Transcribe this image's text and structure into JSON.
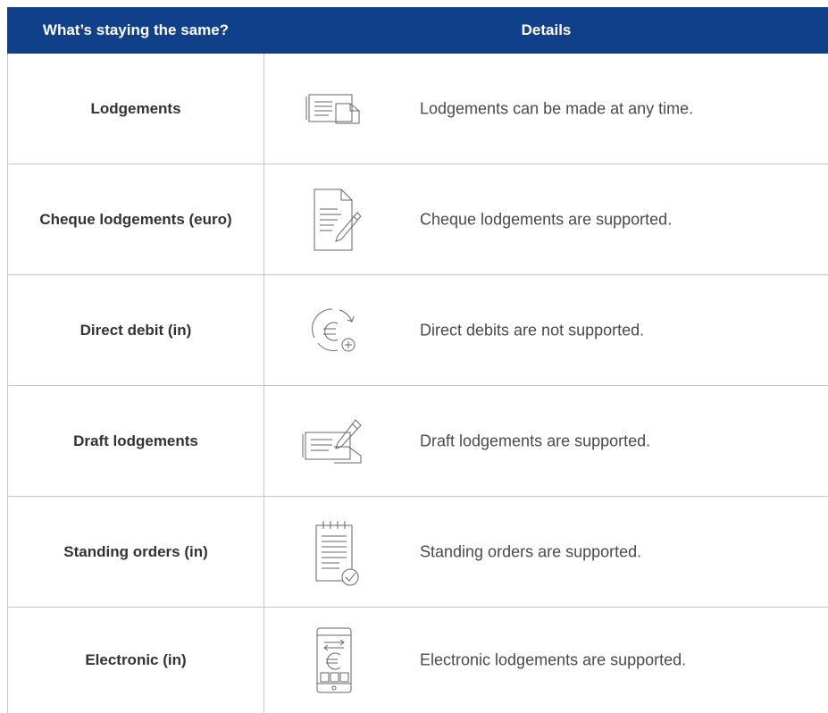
{
  "header": {
    "col1": "What’s staying the same?",
    "col2": "Details"
  },
  "colors": {
    "header_bg": "#11408a",
    "header_text": "#ffffff",
    "grid": "#c6c6c6"
  },
  "rows": [
    {
      "label": "Lodgements",
      "icon": "envelope-document-icon",
      "detail": "Lodgements can be made at any time."
    },
    {
      "label": "Cheque lodgements (euro)",
      "icon": "document-pencil-icon",
      "detail": "Cheque lodgements are supported."
    },
    {
      "label": "Direct debit (in)",
      "icon": "euro-recurring-icon",
      "detail": "Direct debits are not supported."
    },
    {
      "label": "Draft lodgements",
      "icon": "cheque-pen-icon",
      "detail": "Draft lodgements are supported."
    },
    {
      "label": "Standing orders (in)",
      "icon": "notepad-check-icon",
      "detail": "Standing orders are supported."
    },
    {
      "label": "Electronic (in)",
      "icon": "mobile-euro-transfer-icon",
      "detail": "Electronic lodgements are supported."
    }
  ]
}
